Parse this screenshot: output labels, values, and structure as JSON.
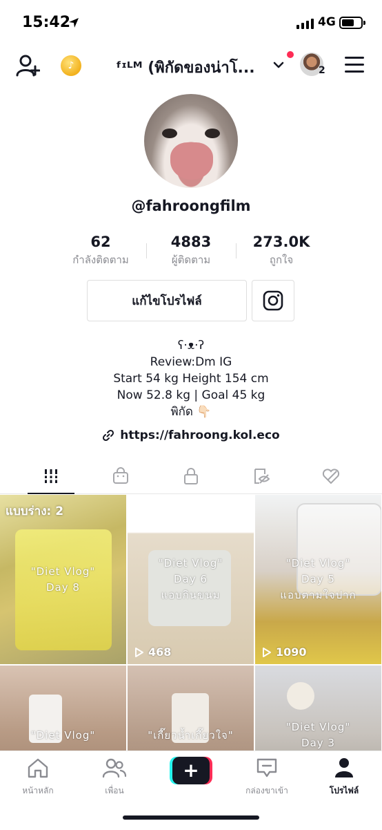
{
  "status_bar": {
    "time": "15:42",
    "network": "4G"
  },
  "header": {
    "account_name": "ᶠᶦᴸᴹ (พิกัดของน่าโ...",
    "account_count": "2",
    "notification_dot_color": "#fe2c55"
  },
  "profile": {
    "username": "@fahroongfilm",
    "stats": [
      {
        "value": "62",
        "label": "กำลังติดตาม"
      },
      {
        "value": "4883",
        "label": "ผู้ติดตาม"
      },
      {
        "value": "273.0K",
        "label": "ถูกใจ"
      }
    ],
    "edit_label": "แก้ไขโปรไฟล์",
    "bio": [
      "ʕ·ᴥ·ʔ",
      "Review:Dm IG",
      "Start 54 kg Height 154 cm",
      "Now 52.8 kg | Goal 45 kg",
      "พิกัด 👇🏻"
    ],
    "link": "https://fahroong.kol.eco"
  },
  "tabs": [
    "videos-grid-icon",
    "shop-bag-icon",
    "lock-icon",
    "eye-off-icon",
    "heart-off-icon"
  ],
  "grid": [
    {
      "draft": "แบบร่าง: 2",
      "caption": [
        "\"Diet Vlog\"",
        "Day 8"
      ],
      "views": ""
    },
    {
      "draft": "",
      "caption": [
        "\"Diet Vlog\"",
        "Day 6",
        "แอบกินขนม"
      ],
      "views": "468"
    },
    {
      "draft": "",
      "caption": [
        "\"Diet Vlog\"",
        "Day 5",
        "แอบตามใจปาก"
      ],
      "views": "1090"
    },
    {
      "draft": "",
      "caption": [
        "\"Diet Vlog\""
      ],
      "views": ""
    },
    {
      "draft": "",
      "caption": [
        "\"เกี๊ยวน้ำเกี๊ยวใจ\""
      ],
      "views": ""
    },
    {
      "draft": "",
      "caption": [
        "\"Diet Vlog\"",
        "Day 3"
      ],
      "views": ""
    }
  ],
  "bottom_nav": {
    "home": "หน้าหลัก",
    "friends": "เพื่อน",
    "inbox": "กล่องขาเข้า",
    "profile": "โปรไฟล์"
  }
}
